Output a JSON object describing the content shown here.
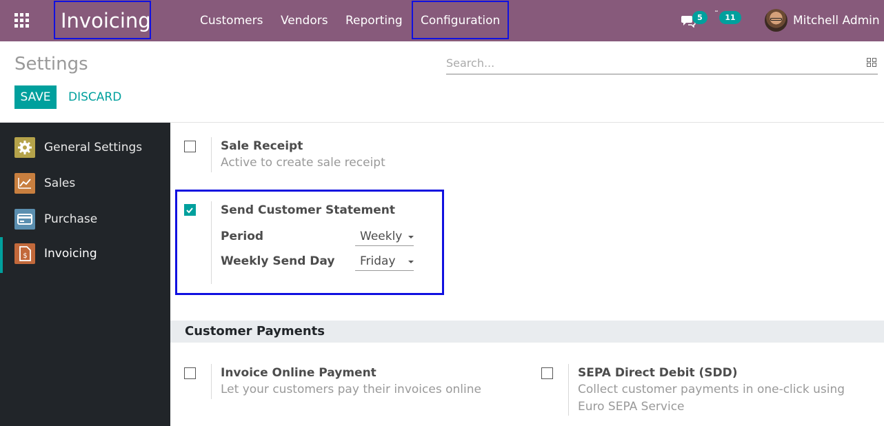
{
  "navbar": {
    "app_title": "Invoicing",
    "menu": [
      "Customers",
      "Vendors",
      "Reporting",
      "Configuration"
    ],
    "messages_count": "5",
    "activities_count": "11",
    "user_name": "Mitchell Admin"
  },
  "control_panel": {
    "title": "Settings",
    "search_placeholder": "Search...",
    "save_label": "SAVE",
    "discard_label": "DISCARD"
  },
  "sidebar": {
    "items": [
      {
        "label": "General Settings",
        "icon": "gear-icon",
        "color": "#b5a34a"
      },
      {
        "label": "Sales",
        "icon": "chart-icon",
        "color": "#c87f3f"
      },
      {
        "label": "Purchase",
        "icon": "card-icon",
        "color": "#5b8fb0"
      },
      {
        "label": "Invoicing",
        "icon": "invoice-icon",
        "color": "#c2693b",
        "active": true
      }
    ]
  },
  "settings": {
    "sale_receipt": {
      "title": "Sale Receipt",
      "description": "Active to create sale receipt",
      "checked": false
    },
    "send_customer_statement": {
      "title": "Send Customer Statement",
      "checked": true,
      "period_label": "Period",
      "period_value": "Weekly",
      "send_day_label": "Weekly Send Day",
      "send_day_value": "Friday"
    },
    "customer_payments": {
      "section_title": "Customer Payments",
      "invoice_online_payment": {
        "title": "Invoice Online Payment",
        "description": "Let your customers pay their invoices online",
        "checked": false
      },
      "sepa": {
        "title": "SEPA Direct Debit (SDD)",
        "description_line1": "Collect customer payments in one-click using",
        "description_line2": "Euro SEPA Service",
        "checked": false
      }
    }
  },
  "colors": {
    "navbar": "#875a7b",
    "accent": "#00a09d",
    "sidebar": "#212529",
    "highlight": "#1010e0"
  }
}
